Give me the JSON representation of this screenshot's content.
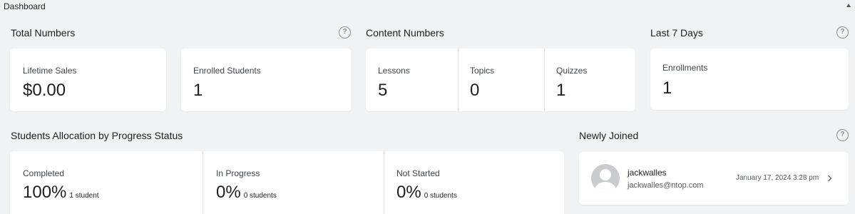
{
  "header": {
    "title": "Dashboard"
  },
  "total_numbers": {
    "title": "Total Numbers",
    "lifetime_sales": {
      "label": "Lifetime Sales",
      "value": "$0.00"
    },
    "enrolled_students": {
      "label": "Enrolled Students",
      "value": "1"
    }
  },
  "content_numbers": {
    "title": "Content Numbers",
    "lessons": {
      "label": "Lessons",
      "value": "5"
    },
    "topics": {
      "label": "Topics",
      "value": "0"
    },
    "quizzes": {
      "label": "Quizzes",
      "value": "1"
    }
  },
  "last_7_days": {
    "title": "Last 7 Days",
    "enrollments": {
      "label": "Enrollments",
      "value": "1"
    }
  },
  "progress_status": {
    "title": "Students Allocation by Progress Status",
    "completed": {
      "label": "Completed",
      "value": "100%",
      "detail": "1 student"
    },
    "in_progress": {
      "label": "In Progress",
      "value": "0%",
      "detail": "0 students"
    },
    "not_started": {
      "label": "Not Started",
      "value": "0%",
      "detail": "0 students"
    }
  },
  "newly_joined": {
    "title": "Newly Joined",
    "users": [
      {
        "username": "jackwalles",
        "email": "jackwalles@ntop.com",
        "date": "January 17, 2024 3:28 pm"
      }
    ]
  },
  "help_glyph": "?",
  "icons": {
    "help": "question-circle-icon",
    "collapse": "triangle-up-icon",
    "avatar": "user-avatar-icon",
    "chevron": "chevron-right-icon"
  }
}
